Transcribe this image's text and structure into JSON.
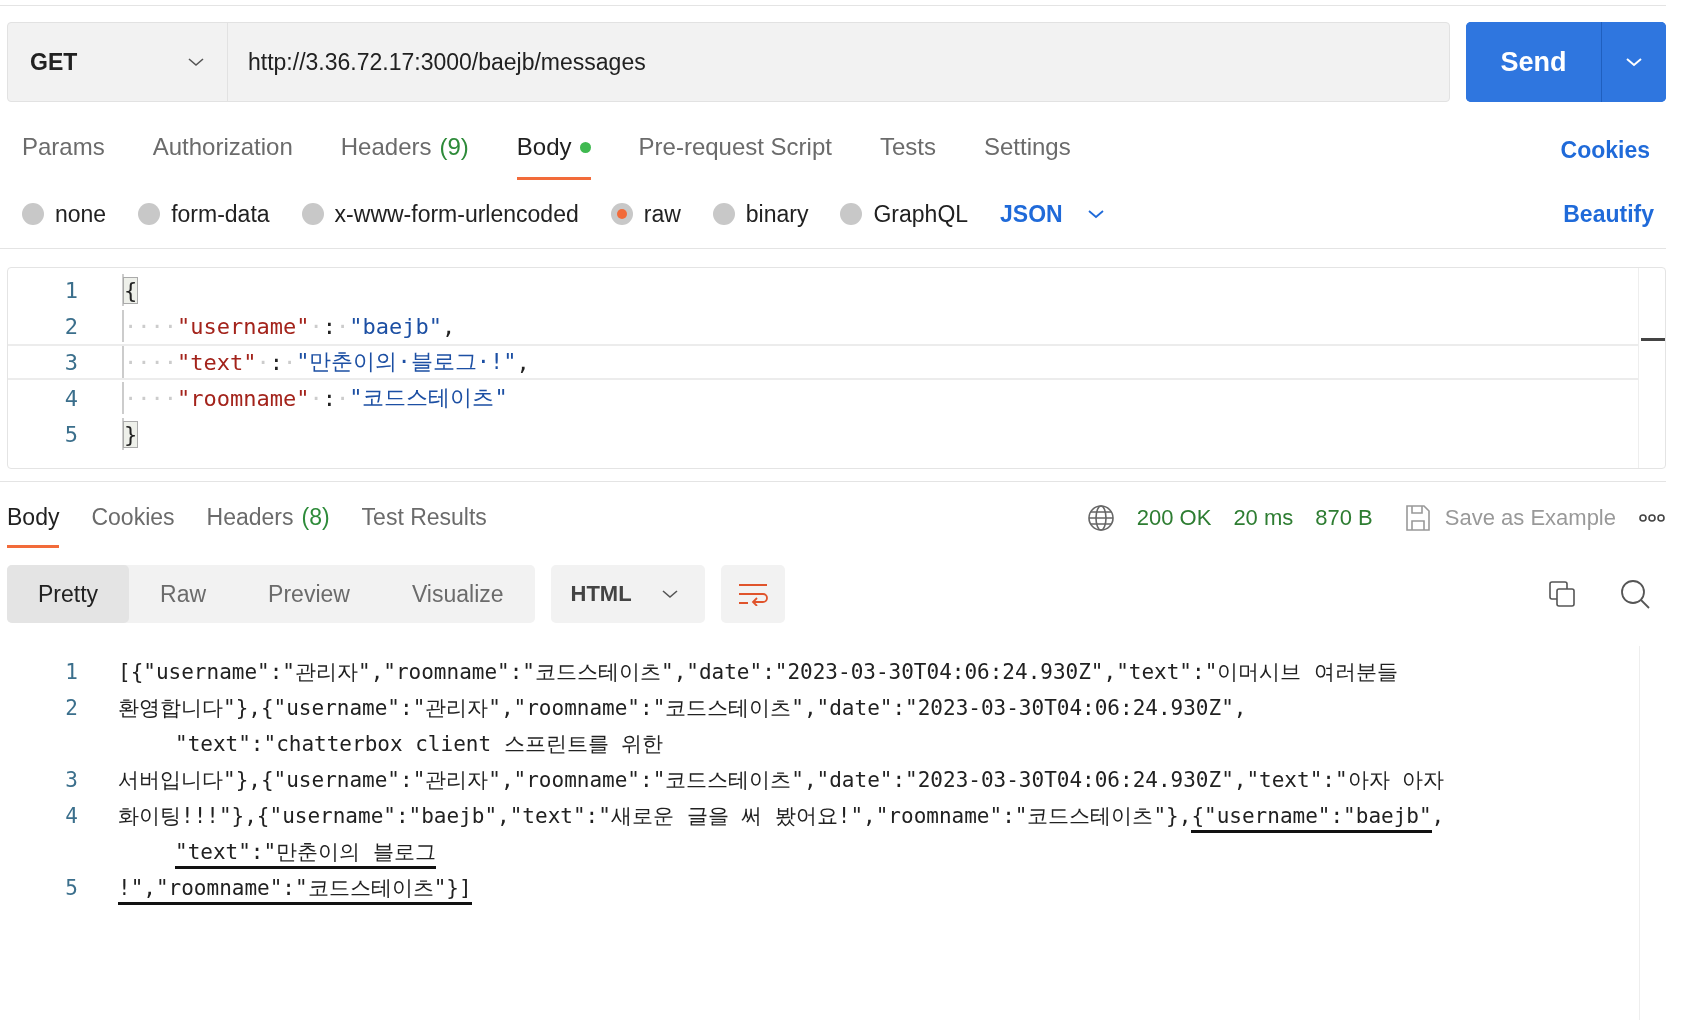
{
  "request": {
    "method": "GET",
    "url": "http://3.36.72.17:3000/baejb/messages",
    "send_label": "Send"
  },
  "request_tabs": [
    {
      "label": "Params",
      "dot": false,
      "selected": false
    },
    {
      "label": "Authorization",
      "dot": false,
      "selected": false
    },
    {
      "label": "Headers",
      "count": "(9)",
      "dot": false,
      "selected": false
    },
    {
      "label": "Body",
      "dot": true,
      "selected": true
    },
    {
      "label": "Pre-request Script",
      "dot": false,
      "selected": false
    },
    {
      "label": "Tests",
      "dot": false,
      "selected": false
    },
    {
      "label": "Settings",
      "dot": false,
      "selected": false
    }
  ],
  "cookies_link": "Cookies",
  "body_types": [
    {
      "label": "none",
      "selected": false
    },
    {
      "label": "form-data",
      "selected": false
    },
    {
      "label": "x-www-form-urlencoded",
      "selected": false
    },
    {
      "label": "raw",
      "selected": true
    },
    {
      "label": "binary",
      "selected": false
    },
    {
      "label": "GraphQL",
      "selected": false
    }
  ],
  "format": "JSON",
  "beautify": "Beautify",
  "editor": {
    "lines": [
      {
        "number": "1",
        "current": false,
        "tokens": [
          {
            "kind": "bracket",
            "text": "{"
          }
        ]
      },
      {
        "number": "2",
        "current": false,
        "tokens": [
          {
            "kind": "ws",
            "text": "····"
          },
          {
            "kind": "key",
            "text": "\"username\""
          },
          {
            "kind": "ws",
            "text": "·"
          },
          {
            "kind": "punct",
            "text": ":"
          },
          {
            "kind": "ws",
            "text": "·"
          },
          {
            "kind": "string",
            "text": "\"baejb\""
          },
          {
            "kind": "punct",
            "text": ","
          }
        ]
      },
      {
        "number": "3",
        "current": true,
        "tokens": [
          {
            "kind": "ws",
            "text": "····"
          },
          {
            "kind": "key",
            "text": "\"text\""
          },
          {
            "kind": "ws",
            "text": "·"
          },
          {
            "kind": "punct",
            "text": ":"
          },
          {
            "kind": "ws",
            "text": "·"
          },
          {
            "kind": "string",
            "text": "\"만춘이의·블로그·!\""
          },
          {
            "kind": "punct",
            "text": ","
          }
        ]
      },
      {
        "number": "4",
        "current": false,
        "tokens": [
          {
            "kind": "ws",
            "text": "····"
          },
          {
            "kind": "key",
            "text": "\"roomname\""
          },
          {
            "kind": "ws",
            "text": "·"
          },
          {
            "kind": "punct",
            "text": ":"
          },
          {
            "kind": "ws",
            "text": "·"
          },
          {
            "kind": "string",
            "text": "\"코드스테이츠\""
          }
        ]
      },
      {
        "number": "5",
        "current": false,
        "tokens": [
          {
            "kind": "bracket",
            "text": "}"
          }
        ]
      }
    ]
  },
  "response_tabs": [
    {
      "label": "Body",
      "selected": true
    },
    {
      "label": "Cookies",
      "selected": false
    },
    {
      "label": "Headers",
      "count": "(8)",
      "selected": false
    },
    {
      "label": "Test Results",
      "selected": false
    }
  ],
  "status": {
    "code": "200 OK",
    "time": "20 ms",
    "size": "870 B"
  },
  "save_example": "Save as Example",
  "view_modes": [
    {
      "label": "Pretty",
      "selected": true
    },
    {
      "label": "Raw",
      "selected": false
    },
    {
      "label": "Preview",
      "selected": false
    },
    {
      "label": "Visualize",
      "selected": false
    }
  ],
  "language": "HTML",
  "response_body": {
    "lines": [
      {
        "number": "1",
        "rows": [
          [
            {
              "text": "[{\"username\":\"관리자\",\"roomname\":\"코드스테이츠\",\"date\":\"2023-03-30T04:06:24.930Z\",\"text\":\"이머시브 여러분들",
              "underlined": false
            }
          ]
        ]
      },
      {
        "number": "2",
        "rows": [
          [
            {
              "text": "환영합니다\"},{\"username\":\"관리자\",\"roomname\":\"코드스테이츠\",\"date\":\"2023-03-30T04:06:24.930Z\",",
              "underlined": false
            }
          ],
          [
            {
              "text": "\"text\":\"chatterbox client 스프린트를 위한",
              "underlined": false
            }
          ]
        ]
      },
      {
        "number": "3",
        "rows": [
          [
            {
              "text": "서버입니다\"},{\"username\":\"관리자\",\"roomname\":\"코드스테이츠\",\"date\":\"2023-03-30T04:06:24.930Z\",\"text\":\"아자 아자",
              "underlined": false
            }
          ]
        ]
      },
      {
        "number": "4",
        "rows": [
          [
            {
              "text": "화이팅!!!\"},{\"username\":\"baejb\",\"text\":\"새로운 글을 써 봤어요!\",\"roomname\":\"코드스테이츠\"},",
              "underlined": false
            },
            {
              "text": "{\"username\":\"baejb\"",
              "underlined": true
            },
            {
              "text": ",",
              "underlined": false
            }
          ],
          [
            {
              "text": "\"text\":\"만춘이의 블로그",
              "underlined": true
            }
          ]
        ]
      },
      {
        "number": "5",
        "rows": [
          [
            {
              "text": "!\",\"roomname\":\"코드스테이츠\"}]",
              "underlined": true
            }
          ]
        ]
      }
    ]
  }
}
